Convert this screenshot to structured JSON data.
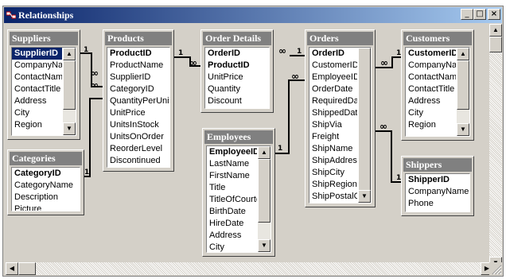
{
  "window": {
    "title": "Relationships",
    "icon": "relationships-icon",
    "controls": {
      "minimize": "_",
      "maximize": "□",
      "close": "×"
    }
  },
  "tables": {
    "suppliers": {
      "title": "Suppliers",
      "fields": [
        "SupplierID",
        "CompanyNam",
        "ContactName",
        "ContactTitle",
        "Address",
        "City",
        "Region"
      ],
      "primary_keys": [
        "SupplierID"
      ],
      "selected": "SupplierID"
    },
    "categories": {
      "title": "Categories",
      "fields": [
        "CategoryID",
        "CategoryName",
        "Description",
        "Picture"
      ],
      "primary_keys": [
        "CategoryID"
      ]
    },
    "products": {
      "title": "Products",
      "fields": [
        "ProductID",
        "ProductName",
        "SupplierID",
        "CategoryID",
        "QuantityPerUnit",
        "UnitPrice",
        "UnitsInStock",
        "UnitsOnOrder",
        "ReorderLevel",
        "Discontinued"
      ],
      "primary_keys": [
        "ProductID"
      ]
    },
    "order_details": {
      "title": "Order Details",
      "fields": [
        "OrderID",
        "ProductID",
        "UnitPrice",
        "Quantity",
        "Discount"
      ],
      "primary_keys": [
        "OrderID",
        "ProductID"
      ]
    },
    "employees": {
      "title": "Employees",
      "fields": [
        "EmployeeID",
        "LastName",
        "FirstName",
        "Title",
        "TitleOfCourtes",
        "BirthDate",
        "HireDate",
        "Address",
        "City"
      ],
      "primary_keys": [
        "EmployeeID"
      ]
    },
    "orders": {
      "title": "Orders",
      "fields": [
        "OrderID",
        "CustomerID",
        "EmployeeID",
        "OrderDate",
        "RequiredDate",
        "ShippedDate",
        "ShipVia",
        "Freight",
        "ShipName",
        "ShipAddress",
        "ShipCity",
        "ShipRegion",
        "ShipPostalCoc"
      ],
      "primary_keys": [
        "OrderID"
      ]
    },
    "customers": {
      "title": "Customers",
      "fields": [
        "CustomerID",
        "CompanyNam",
        "ContactName",
        "ContactTitle",
        "Address",
        "City",
        "Region"
      ],
      "primary_keys": [
        "CustomerID"
      ]
    },
    "shippers": {
      "title": "Shippers",
      "fields": [
        "ShipperID",
        "CompanyName",
        "Phone"
      ],
      "primary_keys": [
        "ShipperID"
      ]
    }
  },
  "relationships": [
    {
      "one": "Suppliers.SupplierID",
      "many": "Products.SupplierID",
      "one_label": "1",
      "many_label": "∞"
    },
    {
      "one": "Categories.CategoryID",
      "many": "Products.CategoryID",
      "one_label": "1",
      "many_label": "∞"
    },
    {
      "one": "Products.ProductID",
      "many": "Order Details.ProductID",
      "one_label": "1",
      "many_label": "∞"
    },
    {
      "one": "Orders.OrderID",
      "many": "Order Details.OrderID",
      "one_label": "1",
      "many_label": "∞"
    },
    {
      "one": "Employees.EmployeeID",
      "many": "Orders.EmployeeID",
      "one_label": "1",
      "many_label": "∞"
    },
    {
      "one": "Customers.CustomerID",
      "many": "Orders.CustomerID",
      "one_label": "1",
      "many_label": "∞"
    },
    {
      "one": "Shippers.ShipperID",
      "many": "Orders.ShipVia",
      "one_label": "1",
      "many_label": "∞"
    }
  ],
  "colors": {
    "titlebar_start": "#0a246a",
    "titlebar_end": "#a6caf0",
    "table_title": "#808080",
    "selection": "#0a246a",
    "face": "#d4d0c8"
  }
}
